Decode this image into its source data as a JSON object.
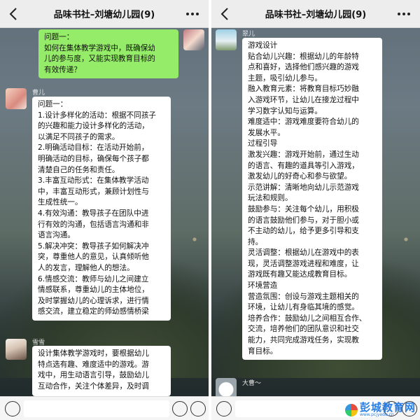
{
  "left": {
    "title": "品味书社–刘塘幼儿园(9)",
    "self_message": [
      "问题一：",
      "如何在集体教学游戏中，既确保幼",
      "儿的参与度，又能实现教育目标的",
      "有效传递？"
    ],
    "msg1_name": "曹儿",
    "msg1_lines": [
      "问题一：",
      "1.设计多样化的活动：根据不同孩子",
      "的兴趣和能力设计多样化的活动，",
      "以满足不同孩子的需求。",
      "2.明确活动目标：在活动开始前，",
      "明确活动的目标，确保每个孩子都",
      "清楚自己的任务和责任。",
      "3.丰富互动形式：在集体教学活动",
      "中，丰富互动形式，兼顾计划性与",
      "生成性统一。",
      "4.有效沟通：教导孩子在团队中进",
      "行有效的沟通，包括语言沟通和非",
      "语言沟通。",
      "5.解决冲突：教导孩子如何解决冲",
      "突，尊重他人的意见，认真倾听他",
      "人的发言，理解他人的想法。",
      "6.情感交流：教师与幼儿之间建立",
      "情感联系，尊重幼儿的主体地位，",
      "及时掌握幼儿的心理诉求，进行情",
      "感交流，建立稳定的师幼感情桥梁"
    ],
    "msg2_name": "雪雪",
    "msg2_lines": [
      "设计集体教学游戏时，要根据幼儿",
      "特点选有趣、难度适中的游戏。游",
      "戏中，用生动语言引导，鼓励幼儿",
      "互动合作，关注个体差异，及时调"
    ]
  },
  "right": {
    "title": "品味书社–刘塘幼儿园(9)",
    "msg1_name": "翠儿",
    "msg1_lines": [
      "游戏设计",
      " 贴合幼儿兴趣：根据幼儿的年龄特",
      "点和喜好，选择他们感兴趣的游戏",
      "主题，吸引幼儿参与。",
      " 融入教育元素：将教育目标巧妙融",
      "入游戏环节，让幼儿在接龙过程中",
      "学习数字认知与运算。",
      " 难度适中：游戏难度要符合幼儿的",
      "发展水平。",
      "过程引导",
      "激发兴趣：游戏开始前，通过生动",
      "的语言、有趣的道具等引入游戏，",
      "激发幼儿的好奇心和参与欲望。",
      "示范讲解：清晰地向幼儿示范游戏",
      "玩法和规则。",
      "鼓励参与：关注每个幼儿，用积极",
      "的语言鼓励他们参与，对于胆小或",
      "不主动的幼儿，给予更多引导和支",
      "持。",
      "灵活调整：根据幼儿在游戏中的表",
      "现，灵活调整游戏进程和难度，让",
      "游戏既有趣又能达成教育目标。",
      "环境营造",
      "营造氛围：创设与游戏主题相关的",
      "环境，让幼儿有身临其境的感觉。",
      "培养合作：鼓励幼儿之间相互合作、",
      "交流，培养他们的团队意识和社交",
      "能力，共同完成游戏任务，实现教",
      "育目标。"
    ],
    "msg2_name": "大曹～"
  },
  "watermark": {
    "text": "彭城教育网",
    "url": "www.pcjyedu.cn"
  },
  "icons": [
    "back-icon",
    "more-icon",
    "voice-icon",
    "emoji-icon",
    "plus-icon"
  ]
}
